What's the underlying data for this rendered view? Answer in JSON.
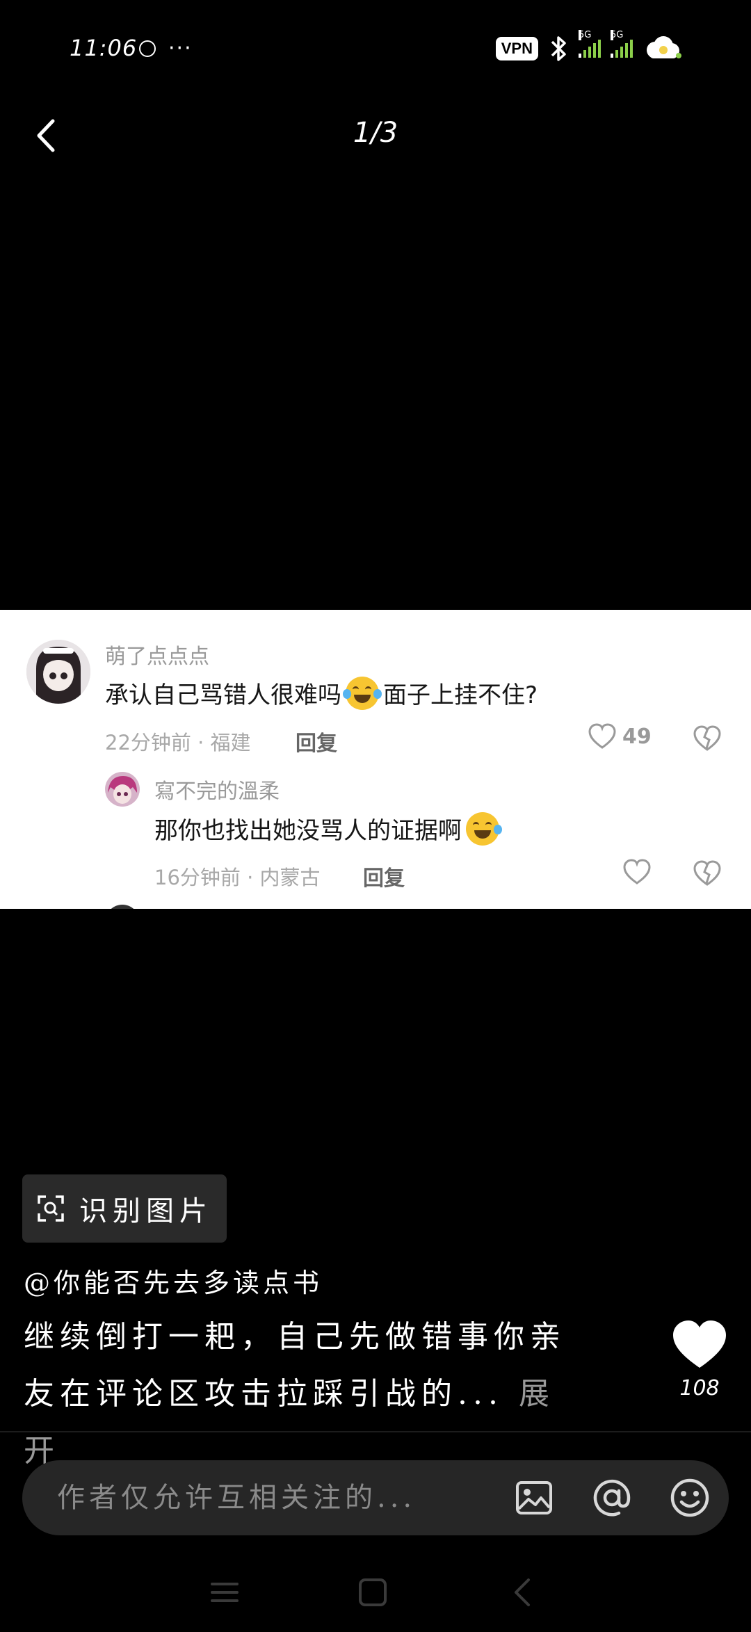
{
  "status_bar": {
    "time": "11:06",
    "dots": "···",
    "vpn": "VPN",
    "sim1_label": "5G",
    "sim2_label": "5G"
  },
  "header": {
    "page_indicator": "1/3"
  },
  "comment_card": {
    "comments": [
      {
        "username": "萌了点点点",
        "text": "承认自己骂错人很难吗",
        "text_after": "面子上挂不住?",
        "meta": "22分钟前 · 福建",
        "reply": "回复",
        "likes": "49"
      },
      {
        "username": "寫不完的溫柔",
        "text": "那你也找出她没骂人的证据啊",
        "meta": "16分钟前 · 内蒙古",
        "reply": "回复",
        "likes": ""
      }
    ]
  },
  "ocr_button": {
    "label": "识别图片"
  },
  "caption": {
    "author": "@你能否先去多读点书",
    "text": "继续倒打一耙，自己先做错事你亲友在评论区攻击拉踩引战的...",
    "expand": "展开"
  },
  "like": {
    "count": "108"
  },
  "input": {
    "placeholder": "作者仅允许互相关注的..."
  },
  "icons": {
    "back": "back-chevron-icon",
    "image": "image-icon",
    "mention": "at-icon",
    "emoji": "emoji-icon",
    "heart": "heart-icon",
    "dislike": "broken-heart-icon",
    "scan": "scan-icon"
  }
}
